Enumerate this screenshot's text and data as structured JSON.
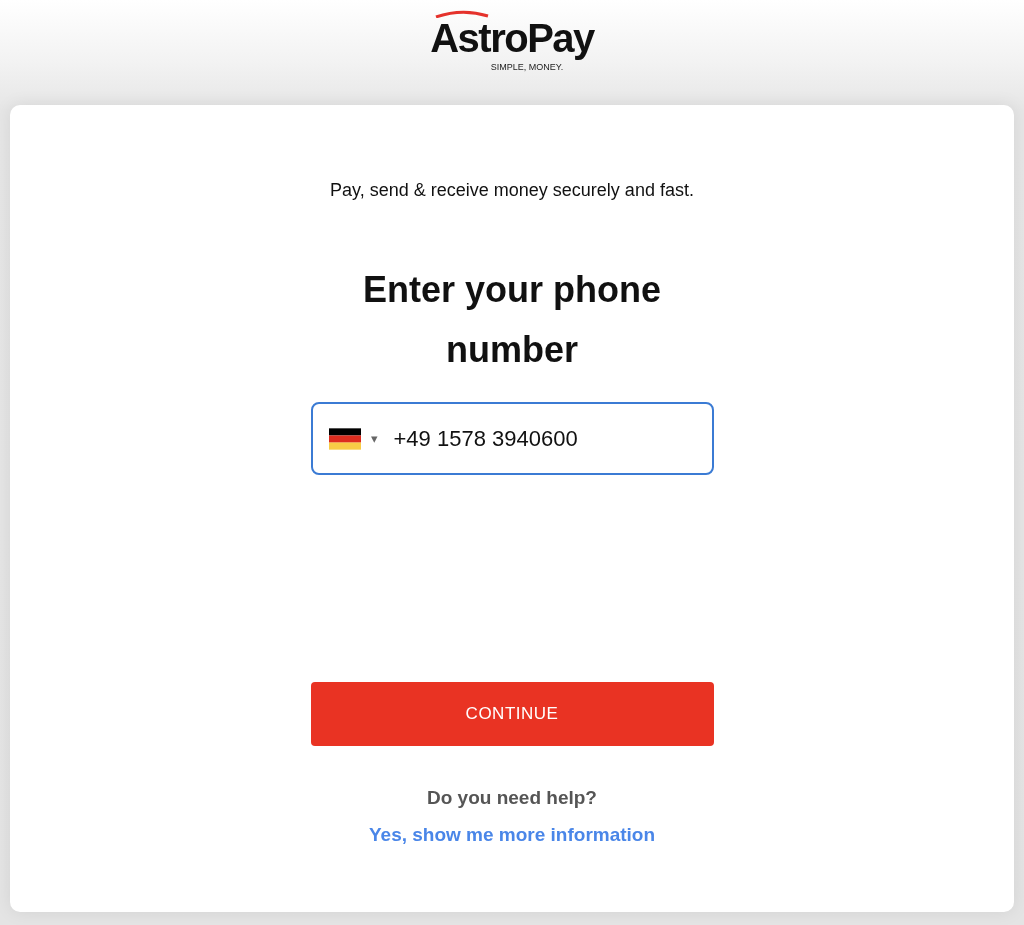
{
  "header": {
    "logo": {
      "name": "AstroPay",
      "tagline": "SIMPLE, MONEY."
    }
  },
  "card": {
    "subtitle": "Pay, send & receive money securely and fast.",
    "title": "Enter your phone number",
    "phone_field": {
      "value": "+49 1578 3940600",
      "focused": true,
      "country_caret": "▾"
    },
    "continue_button": "CONTINUE",
    "help_question": "Do you need help?",
    "help_link": "Yes, show me more information"
  }
}
